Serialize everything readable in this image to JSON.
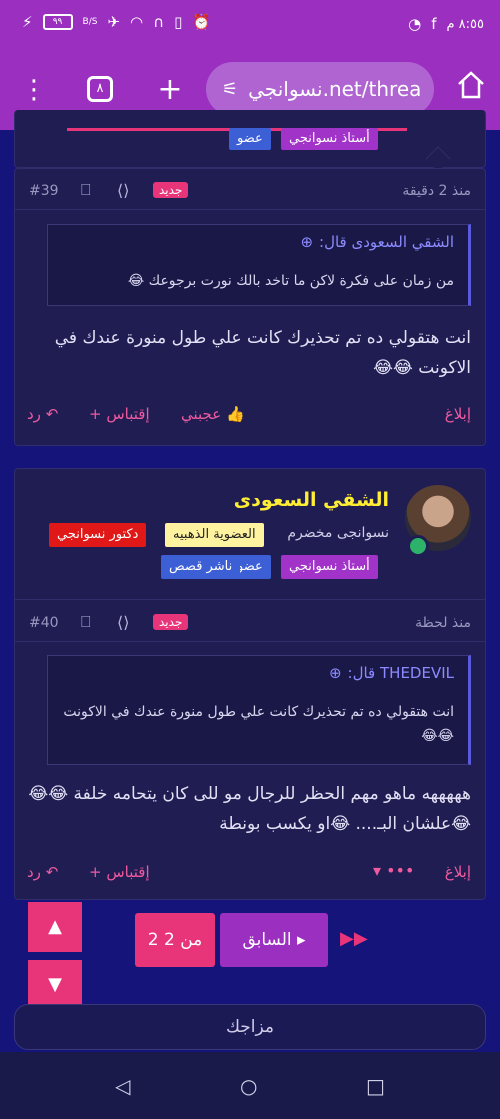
{
  "status": {
    "time": "٨:٥٥ م",
    "battery": "٩٩"
  },
  "browser": {
    "url": "نسوانجي.net/threa",
    "tab_count": "٨"
  },
  "prev_post_badges": [
    "أستاذ نسوانجي",
    "عضو"
  ],
  "post1": {
    "time": "منذ 2 دقيقة",
    "tag": "جديد",
    "number": "#39",
    "quote_author": "الشقي السعودى قال:",
    "quote_text": "من زمان على فكرة لاكن ما تاخد بالك نورت برجوعك 😂",
    "body": "انت هتقولي ده تم تحذيرك كانت علي طول منورة عندك في الاكونت 😂😂",
    "report": "إبلاغ",
    "like": "عجبني",
    "quote_action": "+ إقتباس",
    "reply": "رد"
  },
  "post2": {
    "username": "الشقي السعودى",
    "user_title": "نسوانجى مخضرم",
    "badges_row1": [
      "العضوية الذهبيه",
      "دكتور نسوانجي"
    ],
    "badges_row2": [
      "أستاذ نسوانجي",
      "عضو",
      "ناشر قصص"
    ],
    "time": "منذ لحظة",
    "tag": "جديد",
    "number": "#40",
    "quote_author": "THEDEVIL قال:",
    "quote_text": "انت هتقولي ده تم تحذيرك كانت علي طول منورة عندك في الاكونت 😂😂",
    "body": "هههههه ماهو مهم الحظر للرجال مو للى كان يتحامه خلفة 😂😂😂علشان البـ.... 😂او يكسب بونطة",
    "report": "إبلاغ",
    "quote_action": "+ إقتباس",
    "reply": "رد"
  },
  "pagination": {
    "page": "2 من 2",
    "prev": "السابق"
  },
  "mood": "مزاجك",
  "colors": {
    "accent": "#9b2fc0",
    "pink": "#e8357a",
    "bg": "#14147a"
  }
}
